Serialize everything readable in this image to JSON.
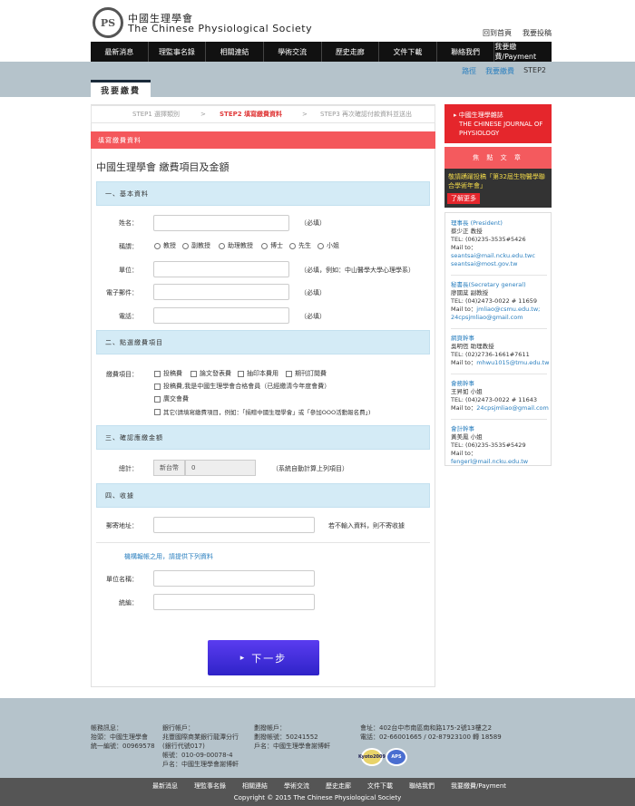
{
  "header": {
    "logo_text": "PS",
    "brand_zh": "中國生理學會",
    "brand_en": "The Chinese Physiological Society",
    "top_links": [
      "回到首頁",
      "我要投稿"
    ]
  },
  "nav": [
    "最新消息",
    "理監事名錄",
    "相關連結",
    "學術交流",
    "歷史走廊",
    "文件下載",
    "聯絡我們",
    "我要繳費/Payment"
  ],
  "breadcrumb": {
    "items": [
      "路徑",
      "我要繳費",
      "STEP2"
    ]
  },
  "page_tab": "我要繳費",
  "steps": {
    "step1": "STEP1 選擇類別",
    "step2": "STEP2 填寫繳費資料",
    "step3": "STEP3 再次確認付款資料並送出",
    "sep": ">"
  },
  "form": {
    "section_bar": "填寫繳費資料",
    "title": "中國生理學會 繳費項目及金額",
    "sec1": "一、基本資料",
    "name_label": "姓名：",
    "name_note": "（必填）",
    "title_label": "稱謂：",
    "titles": [
      "教授",
      "副教授",
      "助理教授",
      "博士",
      "先生",
      "小姐"
    ],
    "unit_label": "單位：",
    "unit_note": "（必填，例如：中山醫學大學心理學系）",
    "email_label": "電子郵件：",
    "email_note": "（必填）",
    "phone_label": "電話：",
    "phone_note": "（必填）",
    "sec2": "二、點選繳費項目",
    "items_label": "繳費項目：",
    "items_row1": [
      "投稿費",
      "論文發表費",
      "抽印本費用",
      "期刊訂閱費"
    ],
    "item_member": "投稿費,我是中國生理學會合格會員（已經繳清今年度會費）",
    "item_social": "廣交會費",
    "item_other": "其它(請填寫繳費項目，例如：「捐贈中國生理學會」或「參加OOO活動報名費」)",
    "sec3": "三、確認應繳金額",
    "total_label": "總計：",
    "currency": "新台幣",
    "amount": "0",
    "total_note": "（系統自動計算上列項目）",
    "sec4": "四、收據",
    "address_label": "郵寄地址：",
    "address_note": "若不輸入資料，則不寄收據",
    "memo": "機構報帳之用，請提供下列資料",
    "org_label": "單位名稱：",
    "taxid_label": "統編：",
    "submit": "下一步",
    "submit_icon": "▸"
  },
  "sidebar": {
    "journal": {
      "arrow": "▸",
      "title_zh": "中國生理學雜誌",
      "title_en": "THE CHINESE JOURNAL OF PHYSIOLOGY"
    },
    "focus": {
      "heading": "焦 點 文 章",
      "text": "敬請踴躍投稿「第32屆生物醫學聯合學術年會」",
      "more": "了解更多"
    },
    "people": [
      {
        "role": "理事長 (President)",
        "name": "蔡少正 教授",
        "tel": "TEL: (06)235-3535#5426",
        "mail_label": "Mail to：",
        "mails": [
          "seantsai@mail.ncku.edu.twc",
          "seantsai@most.gov.tw"
        ]
      },
      {
        "role": "秘書長(Secretary general)",
        "name": "廖國棻 副教授",
        "tel": "TEL: (04)2473-0022 # 11659",
        "mail_label": "Mail to：",
        "mails": [
          "jmliao@csmu.edu.tw;",
          "24cpsjmliao@gmail.com"
        ]
      },
      {
        "role": "網頁幹事",
        "name": "吳明恆 助理教授",
        "tel": "TEL: (02)2736-1661#7611",
        "mail_label": "Mail to：",
        "mails": [
          "mhwu1015@tmu.edu.tw"
        ]
      },
      {
        "role": "會務幹事",
        "name": "王昇如 小姐",
        "tel": "TEL: (04)2473-0022 # 11643",
        "mail_label": "Mail to：",
        "mails": [
          "24cpsjmliao@gmail.com"
        ]
      },
      {
        "role": "會計幹事",
        "name": "黃美鳳 小姐",
        "tel": "TEL: (06)235-3535#5429",
        "mail_label": "Mail to：",
        "mails": [
          "fengerl@mail.ncku.edu.tw"
        ]
      }
    ]
  },
  "footer": {
    "col1": [
      "帳務訊息：",
      "抬頭：中國生理學會",
      "統一編號：00969578"
    ],
    "col2": [
      "銀行帳戶：",
      "兆豐國際商業銀行龍潭分行",
      "(銀行代號017)",
      "帳號：010-09-00078-4",
      "戶名：中國生理學會謝博軒"
    ],
    "col3": [
      "劃撥帳戶：",
      "劃撥帳號：50241552",
      "戶名：中國生理學會謝博軒"
    ],
    "col4": [
      "會址：402台中市南區南和路175-2號13樓之2",
      "電話：02-66001665 / 02-87923100 轉 18589"
    ],
    "badge1": "Kyoto2009",
    "badge2": "APS",
    "nav": [
      "最新消息",
      "理監事名錄",
      "相關連結",
      "學術交流",
      "歷史走廊",
      "文件下載",
      "聯絡我們",
      "我要繳費/Payment"
    ],
    "copyright": "Copyright © 2015 The Chinese Physiological Society"
  }
}
